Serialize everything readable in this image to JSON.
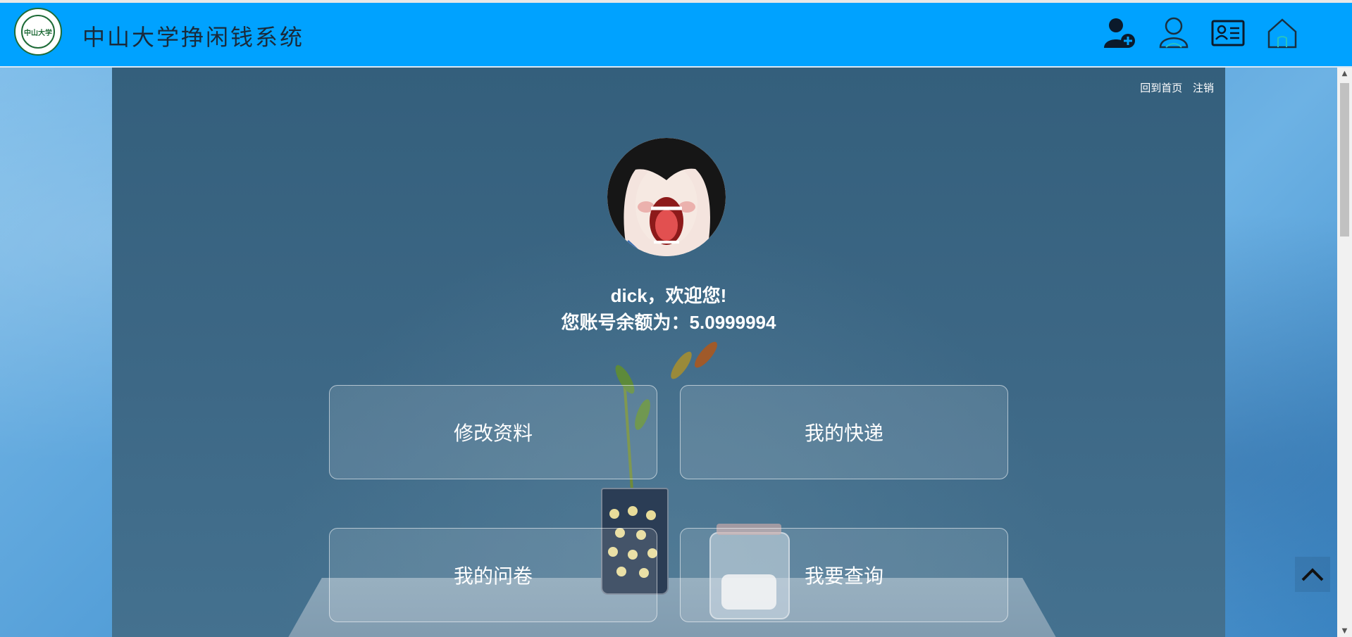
{
  "header": {
    "logo_text": "中山大学",
    "title": "中山大学挣闲钱系统",
    "icons": [
      "add-user-icon",
      "user-icon",
      "id-card-icon",
      "home-icon"
    ]
  },
  "top_links": {
    "home": "回到首页",
    "logout": "注销"
  },
  "welcome": {
    "greeting": "dick，欢迎您!",
    "balance_line": "您账号余额为：5.0999994"
  },
  "cards": {
    "edit_profile": "修改资料",
    "my_express": "我的快递",
    "my_survey": "我的问卷",
    "query": "我要查询"
  },
  "colors": {
    "header_bg": "#00a2ff",
    "panel_bg": "#3d6886",
    "text": "#ffffff"
  }
}
